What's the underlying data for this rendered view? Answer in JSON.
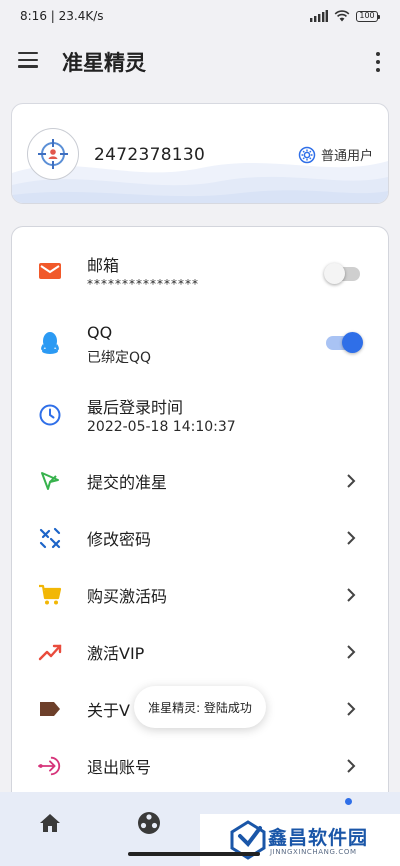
{
  "status_bar": {
    "time": "8:16",
    "speed": "23.4K/s",
    "battery": "100"
  },
  "app_bar": {
    "title": "准星精灵"
  },
  "account": {
    "qq_number": "2472378130",
    "user_type": "普通用户"
  },
  "settings": {
    "email": {
      "title": "邮箱",
      "value": "****************",
      "enabled": false
    },
    "qq": {
      "title": "QQ",
      "value": "已绑定QQ",
      "enabled": true
    },
    "last_login": {
      "title": "最后登录时间",
      "value": "2022-05-18 14:10:37"
    },
    "submitted": {
      "title": "提交的准星"
    },
    "change_password": {
      "title": "修改密码"
    },
    "buy_code": {
      "title": "购买激活码"
    },
    "activate_vip": {
      "title": "激活VIP"
    },
    "about": {
      "title": "关于V"
    },
    "logout": {
      "title": "退出账号"
    }
  },
  "toast": {
    "message": "准星精灵: 登陆成功"
  },
  "colors": {
    "accent": "#2f6fe8",
    "email_icon": "#f1592a",
    "qq_icon": "#2b9af3",
    "clock_icon": "#2f6fe8",
    "cart_icon": "#f2b705",
    "vip_icon": "#e94b3c",
    "tag_icon": "#6d3f2a",
    "logout_icon": "#d6347a",
    "password_icon": "#1c64c8",
    "submit_icon": "#37b24d"
  },
  "watermark": {
    "name": "鑫昌软件园",
    "url": "JINNGXINCHANG.COM"
  }
}
